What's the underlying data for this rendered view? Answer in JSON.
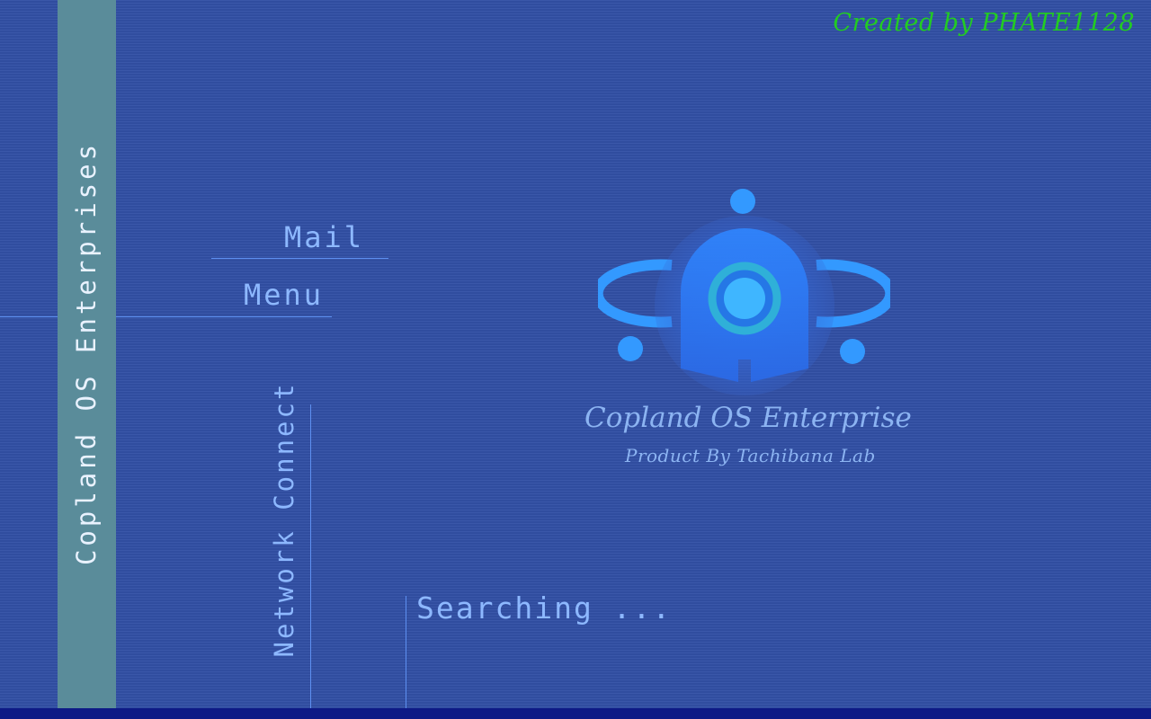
{
  "credit": "Created by PHATE1128",
  "sidebar": {
    "title": "Copland OS Enterprises"
  },
  "menu": {
    "mail": "Mail",
    "menu": "Menu",
    "network": "Network Connect"
  },
  "status": "Searching ...",
  "brand": {
    "title": "Copland OS Enterprise",
    "subtitle": "Product By Tachibana Lab"
  },
  "colors": {
    "background": "#3351a6",
    "side_strip": "#5a8c9a",
    "accent": "#8db8ff",
    "credit": "#22cc22",
    "taskbar": "#0e1a86",
    "logo": "#3399ff"
  },
  "icons": {
    "logo": "copland-os-logo-icon"
  }
}
